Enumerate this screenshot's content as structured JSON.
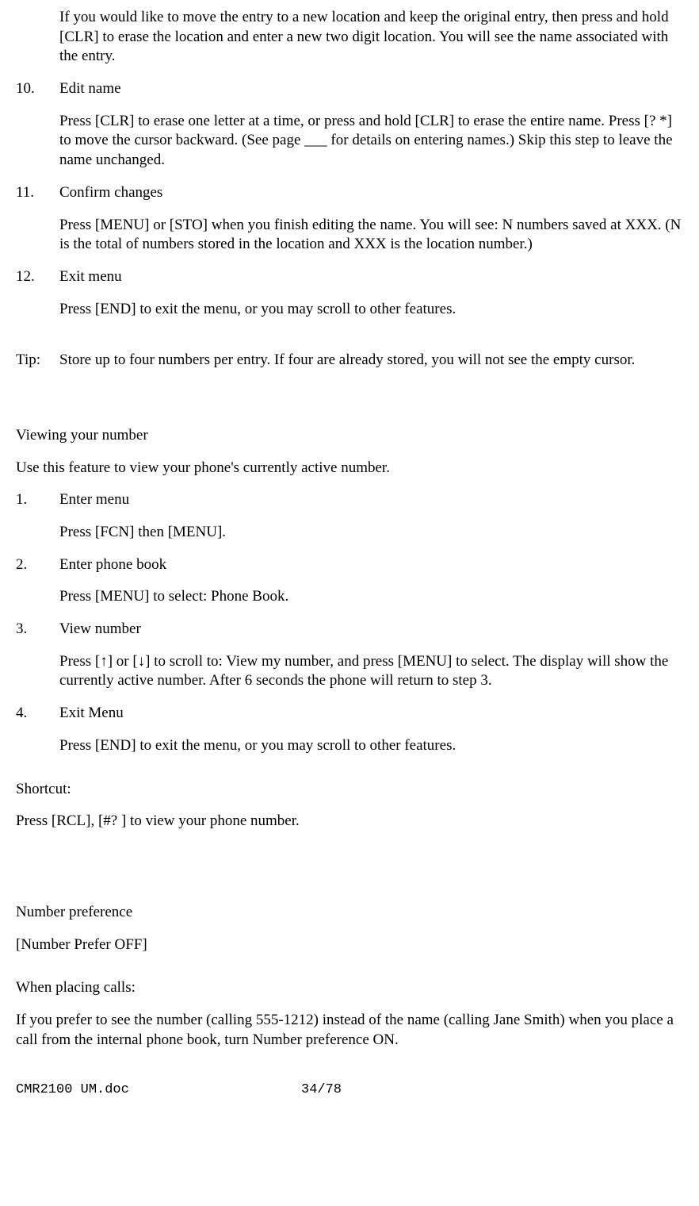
{
  "top_block": "If you would like to move the entry to a new location and keep the original entry, then press and hold [CLR] to erase the location and enter a new two digit location. You will see the name associated with the entry.",
  "step10_num": "10.",
  "step10_title": "Edit name",
  "step10_body": "Press [CLR] to erase one letter at a time, or press and hold [CLR] to erase the entire name. Press [?  *] to move the cursor backward. (See page ___ for details on entering names.) Skip this step to leave the name unchanged.",
  "step11_num": "11.",
  "step11_title": "Confirm changes",
  "step11_body": "Press [MENU] or [STO] when you finish editing the name. You will see: N numbers saved at XXX. (N is the total of numbers stored in the location and XXX is the location number.)",
  "step12_num": "12.",
  "step12_title": "Exit menu",
  "step12_body": "Press [END] to exit the menu, or you may scroll to other features.",
  "tip_label": "Tip:",
  "tip_body": "Store up to four numbers per entry. If four are already stored, you will not see the empty cursor.",
  "viewing_title": "Viewing your number",
  "viewing_intro": "Use this feature to view your phone's currently active number.",
  "v1_num": "1.",
  "v1_title": "Enter menu",
  "v1_body": "Press [FCN] then [MENU].",
  "v2_num": "2.",
  "v2_title": "Enter phone book",
  "v2_body": "Press [MENU] to select: Phone Book.",
  "v3_num": "3.",
  "v3_title": "View number",
  "v3_body": "Press [↑] or [↓] to scroll to: View my number, and press [MENU] to select. The display will show the currently active number. After 6 seconds the phone will return to step 3.",
  "v4_num": "4.",
  "v4_title": "Exit Menu",
  "v4_body": "Press [END] to exit the menu, or you may scroll to other features.",
  "shortcut_label": "Shortcut:",
  "shortcut_body": "Press [RCL], [#?  ] to view your phone number.",
  "numpref_title": "Number preference",
  "numpref_label": "[Number Prefer OFF]",
  "placing_title": "When placing calls:",
  "placing_body": "If you prefer to see the number (calling 555-1212) instead of the name (calling Jane Smith) when you place a call from the internal phone book, turn Number preference ON.",
  "footer_left": "CMR2100 UM.doc",
  "footer_page": "34/78"
}
